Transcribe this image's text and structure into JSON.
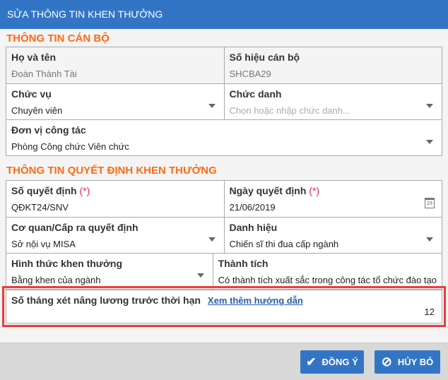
{
  "title": "SỬA THÔNG TIN KHEN THƯỞNG",
  "section1": {
    "title": "THÔNG TIN CÁN BỘ",
    "ho_ten": {
      "label": "Họ và tên",
      "value": "Đoàn Thành Tài"
    },
    "so_hieu": {
      "label": "Số hiệu cán bộ",
      "value": "SHCBA29"
    },
    "chuc_vu": {
      "label": "Chức vụ",
      "value": "Chuyên viên"
    },
    "chuc_danh": {
      "label": "Chức danh",
      "placeholder": "Chọn hoặc nhập chức danh..."
    },
    "don_vi": {
      "label": "Đơn vị công tác",
      "value": "Phòng Công chức Viên chức"
    }
  },
  "section2": {
    "title": "THÔNG TIN QUYẾT ĐỊNH KHEN THƯỞNG",
    "required_mark": "(*)",
    "so_qd": {
      "label": "Số quyết định",
      "value": "QĐKT24/SNV"
    },
    "ngay_qd": {
      "label": "Ngày quyết định",
      "value": "21/06/2019",
      "calendar_day": "23"
    },
    "co_quan": {
      "label": "Cơ quan/Cấp ra quyết định",
      "value": "Sở nội vụ MISA"
    },
    "danh_hieu": {
      "label": "Danh hiệu",
      "value": "Chiến sĩ thi đua cấp ngành"
    },
    "hinh_thuc": {
      "label": "Hình thức khen thưởng",
      "value": "Bằng khen của ngành"
    },
    "thanh_tich": {
      "label": "Thành tích",
      "value": "Có thành tích xuất sắc trong công tác tổ chức đào tạo"
    },
    "so_thang": {
      "label": "Số tháng xét nâng lương trước thời hạn",
      "link": "Xem thêm hướng dẫn",
      "value": "12"
    }
  },
  "buttons": {
    "ok": "ĐỒNG Ý",
    "cancel": "HỦY BỎ"
  },
  "colors": {
    "header": "#3375c5",
    "section": "#ff6a13",
    "highlight": "#ee3b3b"
  }
}
